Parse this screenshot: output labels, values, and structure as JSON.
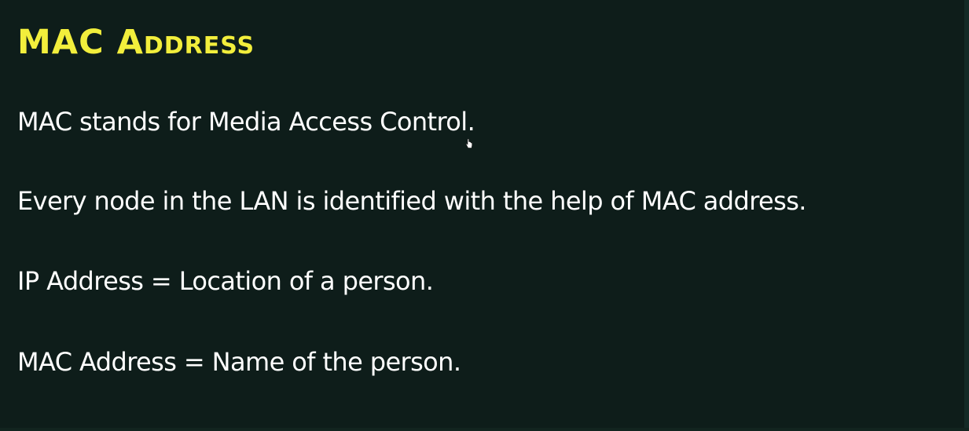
{
  "slide": {
    "title": "MAC Address",
    "lines": [
      "MAC stands for Media Access Control.",
      "Every node in the LAN is identified with the help of MAC address.",
      "IP Address = Location of a person.",
      "MAC Address = Name of the person."
    ]
  },
  "cursor": {
    "icon": "hand-pointer-icon"
  },
  "colors": {
    "background": "#0e1d1a",
    "title": "#f2ee3c",
    "text": "#ffffff"
  }
}
